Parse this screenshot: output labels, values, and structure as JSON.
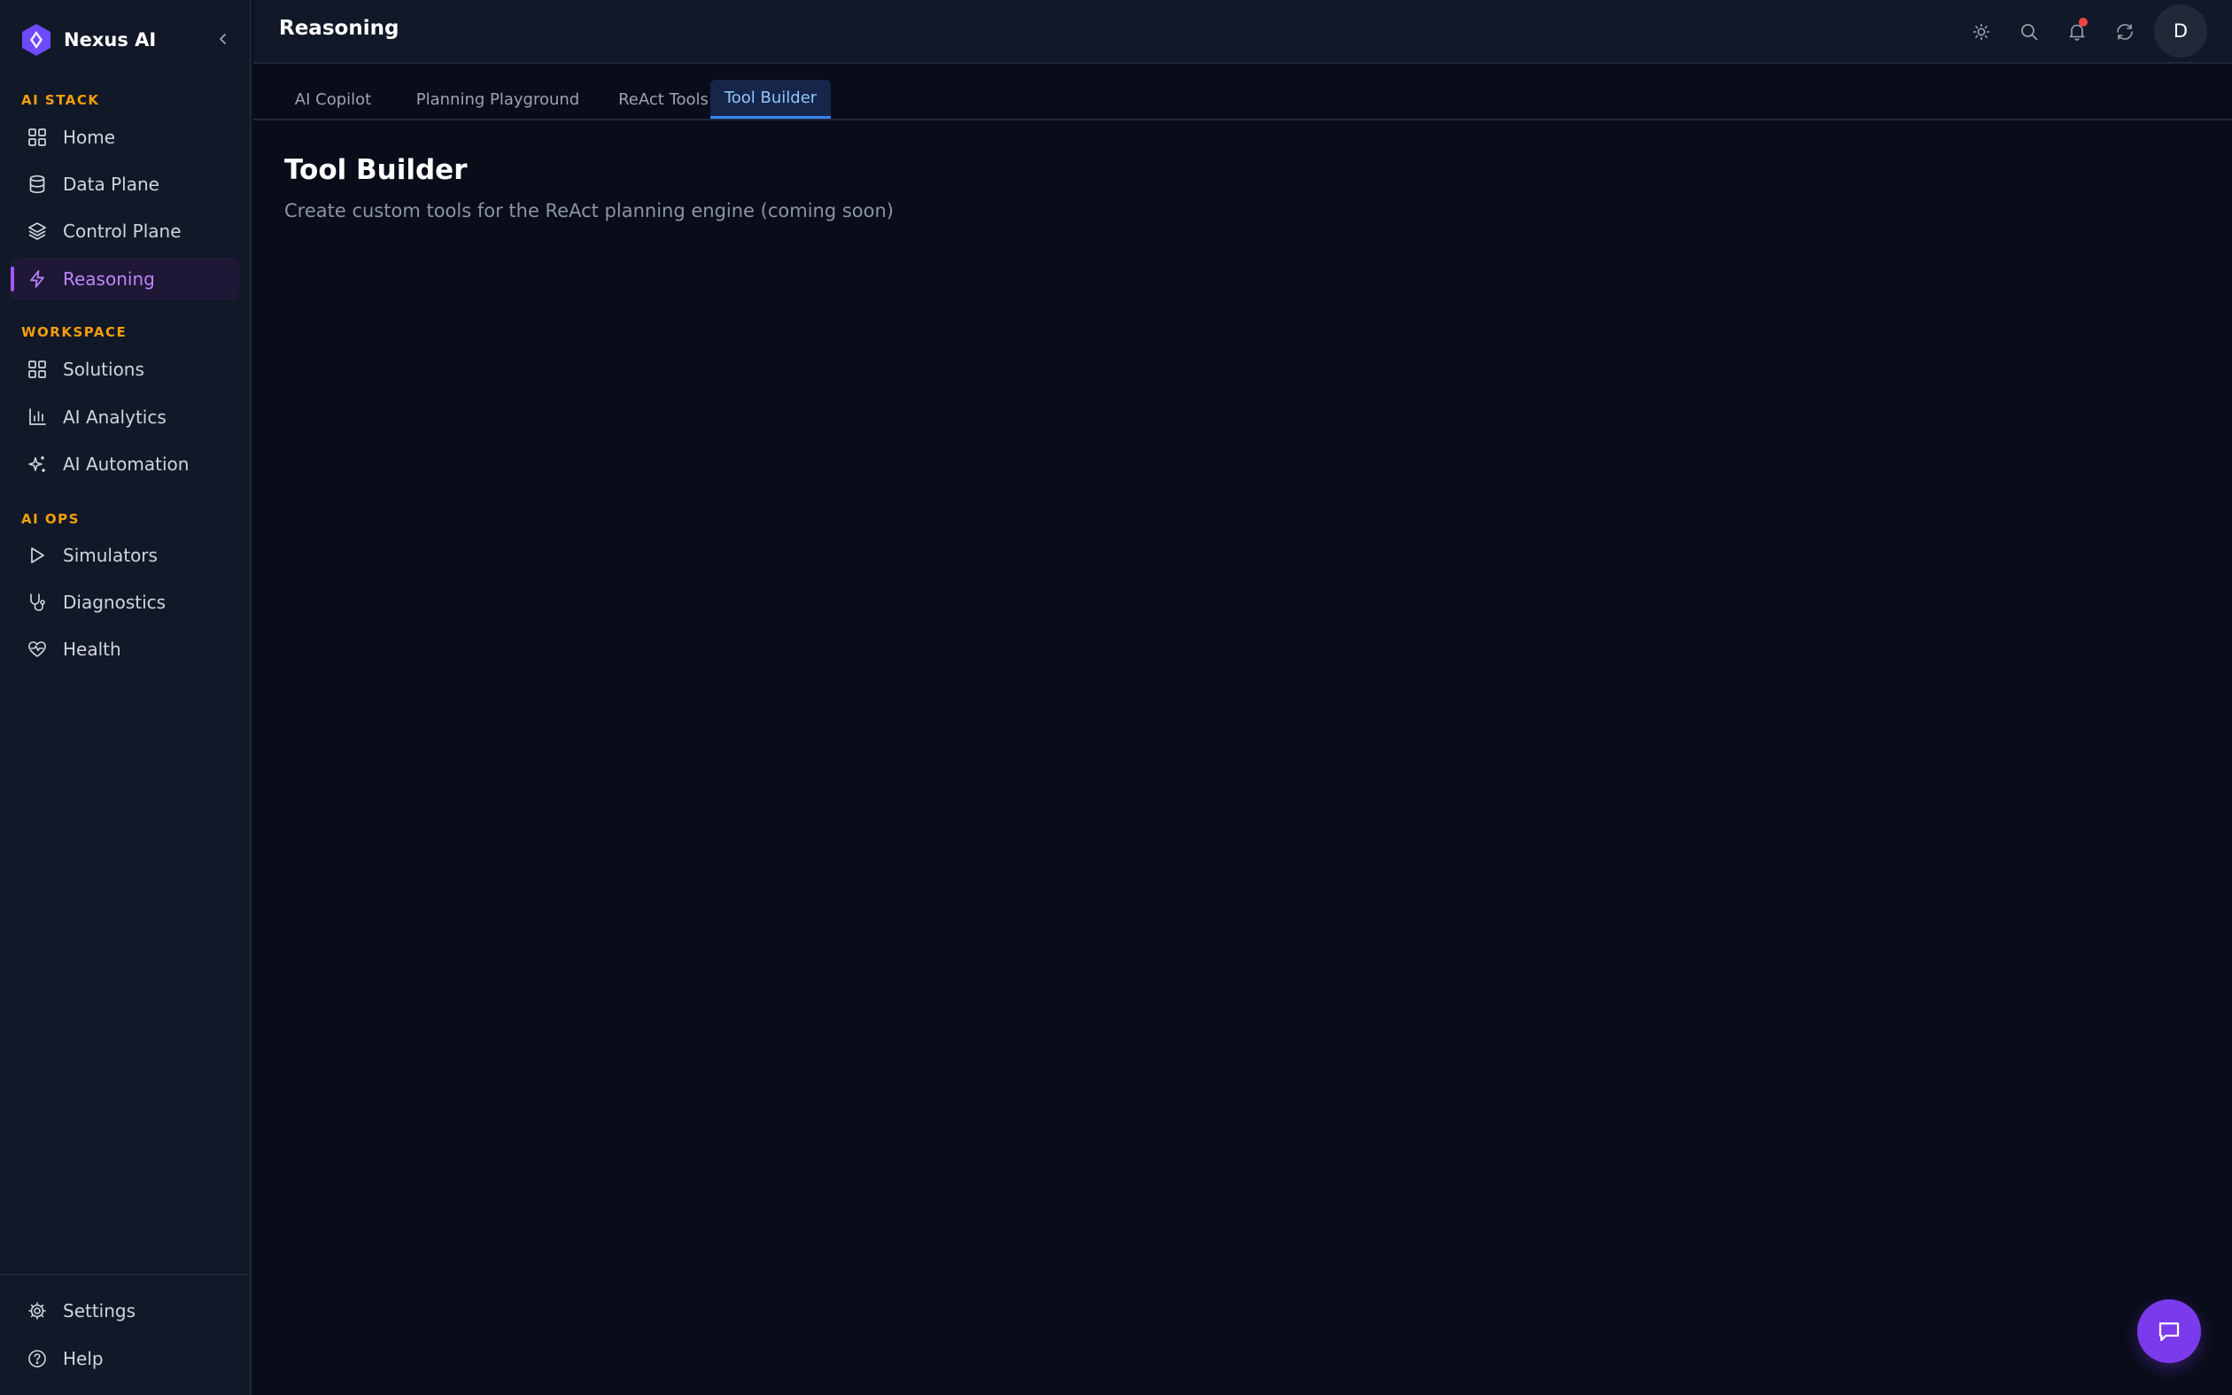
{
  "brand": {
    "name": "Nexus AI"
  },
  "colors": {
    "accent": "#a855f7",
    "section_label": "#f59e0b",
    "tab_active": "#3b82f6",
    "notification": "#ef4444",
    "fab": "#7c3aed"
  },
  "sidebar": {
    "sections": [
      {
        "label": "AI STACK",
        "items": [
          {
            "label": "Home",
            "icon": "grid-icon"
          },
          {
            "label": "Data Plane",
            "icon": "database-icon"
          },
          {
            "label": "Control Plane",
            "icon": "layers-icon"
          },
          {
            "label": "Reasoning",
            "icon": "zap-icon",
            "active": true
          }
        ]
      },
      {
        "label": "WORKSPACE",
        "items": [
          {
            "label": "Solutions",
            "icon": "grid-icon"
          },
          {
            "label": "AI Analytics",
            "icon": "bar-chart-icon"
          },
          {
            "label": "AI Automation",
            "icon": "sparkles-icon"
          }
        ]
      },
      {
        "label": "AI OPS",
        "items": [
          {
            "label": "Simulators",
            "icon": "play-icon"
          },
          {
            "label": "Diagnostics",
            "icon": "stethoscope-icon"
          },
          {
            "label": "Health",
            "icon": "heart-pulse-icon"
          }
        ]
      }
    ],
    "footer": [
      {
        "label": "Settings",
        "icon": "gear-icon"
      },
      {
        "label": "Help",
        "icon": "help-circle-icon"
      }
    ]
  },
  "header": {
    "title": "Reasoning",
    "icons": [
      "sun-icon",
      "search-icon",
      "bell-icon",
      "refresh-icon"
    ],
    "avatar_initial": "D"
  },
  "tabs": [
    {
      "label": "AI Copilot"
    },
    {
      "label": "Planning Playground"
    },
    {
      "label": "ReAct Tools"
    },
    {
      "label": "Tool Builder",
      "active": true
    }
  ],
  "main": {
    "title": "Tool Builder",
    "subtitle": "Create custom tools for the ReAct planning engine (coming soon)"
  },
  "chat_fab": {
    "icon": "message-square-icon"
  }
}
